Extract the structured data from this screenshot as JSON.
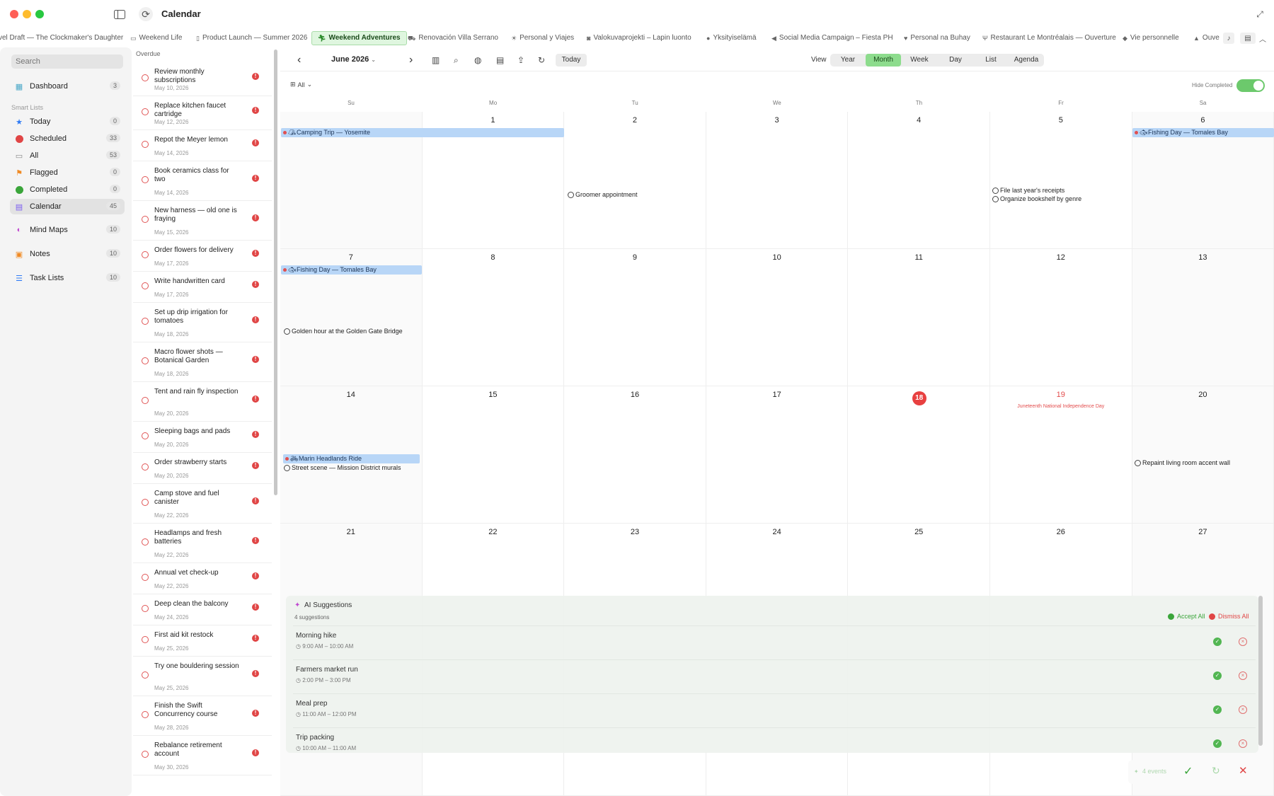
{
  "window": {
    "title": "Calendar"
  },
  "tabs": [
    {
      "label": "vel Draft — The Clockmaker's Daughter",
      "icon": ""
    },
    {
      "label": "Weekend Life",
      "icon": "sofa-icon"
    },
    {
      "label": "Product Launch — Summer 2026",
      "icon": "document-icon"
    },
    {
      "label": "Weekend Adventures",
      "icon": "hiker-icon"
    },
    {
      "label": "Renovación Villa Serrano",
      "icon": "excavator-icon"
    },
    {
      "label": "Personal y Viajes",
      "icon": "sun-icon"
    },
    {
      "label": "Valokuvaprojekti – Lapin luonto",
      "icon": "camera-icon"
    },
    {
      "label": "Yksityiselämä",
      "icon": "circle-icon"
    },
    {
      "label": "Social Media Campaign – Fiesta PH",
      "icon": "megaphone-icon"
    },
    {
      "label": "Personal na Buhay",
      "icon": "heart-icon"
    },
    {
      "label": "Restaurant Le Montréalais — Ouverture",
      "icon": "fork-icon"
    },
    {
      "label": "Vie personnelle",
      "icon": "tag-icon"
    },
    {
      "label": "Ouve",
      "icon": "triangle-icon"
    }
  ],
  "sidebar": {
    "search_placeholder": "Search",
    "dashboard": {
      "label": "Dashboard",
      "count": "3"
    },
    "smart_lists_label": "Smart Lists",
    "smart_lists": [
      {
        "label": "Today",
        "count": "0",
        "icon": "star-icon",
        "color": "#2f7bf5"
      },
      {
        "label": "Scheduled",
        "count": "33",
        "icon": "clock-icon",
        "color": "#e04545"
      },
      {
        "label": "All",
        "count": "53",
        "icon": "tray-icon",
        "color": "#888888"
      },
      {
        "label": "Flagged",
        "count": "0",
        "icon": "flag-icon",
        "color": "#f08a24"
      },
      {
        "label": "Completed",
        "count": "0",
        "icon": "check-circle-icon",
        "color": "#3aa53a"
      },
      {
        "label": "Calendar",
        "count": "45",
        "icon": "calendar-icon",
        "color": "#7a5cf0"
      }
    ],
    "other": [
      {
        "label": "Mind Maps",
        "count": "10",
        "icon": "brain-icon",
        "color": "#c04ad0"
      },
      {
        "label": "Notes",
        "count": "10",
        "icon": "note-icon",
        "color": "#f08a24"
      },
      {
        "label": "Task Lists",
        "count": "10",
        "icon": "list-icon",
        "color": "#2f7bf5"
      }
    ]
  },
  "overdue": {
    "header": "Overdue",
    "items": [
      {
        "title": "Review monthly subscriptions",
        "date": "May 10, 2026"
      },
      {
        "title": "Replace kitchen faucet cartridge",
        "date": "May 12, 2026"
      },
      {
        "title": "Repot the Meyer lemon",
        "date": "May 14, 2026"
      },
      {
        "title": "Book ceramics class for two",
        "date": "May 14, 2026"
      },
      {
        "title": "New harness — old one is fraying",
        "date": "May 15, 2026"
      },
      {
        "title": "Order flowers for delivery",
        "date": "May 17, 2026"
      },
      {
        "title": "Write handwritten card",
        "date": "May 17, 2026"
      },
      {
        "title": "Set up drip irrigation for tomatoes",
        "date": "May 18, 2026"
      },
      {
        "title": "Macro flower shots — Botanical Garden",
        "date": "May 18, 2026"
      },
      {
        "title": "Tent and rain fly inspection",
        "date": "May 20, 2026"
      },
      {
        "title": "Sleeping bags and pads",
        "date": "May 20, 2026"
      },
      {
        "title": "Order strawberry starts",
        "date": "May 20, 2026"
      },
      {
        "title": "Camp stove and fuel canister",
        "date": "May 22, 2026"
      },
      {
        "title": "Headlamps and fresh batteries",
        "date": "May 22, 2026"
      },
      {
        "title": "Annual vet check-up",
        "date": "May 22, 2026"
      },
      {
        "title": "Deep clean the balcony",
        "date": "May 24, 2026"
      },
      {
        "title": "First aid kit restock",
        "date": "May 25, 2026"
      },
      {
        "title": "Try one bouldering session",
        "date": "May 25, 2026"
      },
      {
        "title": "Finish the Swift Concurrency course",
        "date": "May 28, 2026"
      },
      {
        "title": "Rebalance retirement account",
        "date": "May 30, 2026"
      }
    ]
  },
  "calendar": {
    "month_label": "June 2026",
    "today_label": "Today",
    "view_label": "View",
    "views": [
      "Year",
      "Month",
      "Week",
      "Day",
      "List",
      "Agenda"
    ],
    "active_view": "Month",
    "filter_label": "All",
    "hide_completed_label": "Hide Completed",
    "weekdays": [
      "Su",
      "Mo",
      "Tu",
      "We",
      "Th",
      "Fr",
      "Sa"
    ],
    "weeks": [
      [
        "",
        "1",
        "2",
        "3",
        "4",
        "5",
        "6"
      ],
      [
        "7",
        "8",
        "9",
        "10",
        "11",
        "12",
        "13"
      ],
      [
        "14",
        "15",
        "16",
        "17",
        "18",
        "19",
        "20"
      ],
      [
        "21",
        "22",
        "23",
        "24",
        "25",
        "26",
        "27"
      ]
    ],
    "today_day": "18",
    "holiday": {
      "day": "19",
      "label": "Juneteenth National Independence Day"
    },
    "events": [
      {
        "title": "Camping Trip — Yosemite",
        "icon": "tent-icon"
      },
      {
        "title": "Fishing Day — Tomales Bay",
        "icon": "fish-icon"
      },
      {
        "title": "Fishing Day — Tomales Bay",
        "icon": "fish-icon"
      },
      {
        "title": "Marin Headlands Ride",
        "icon": "bike-icon"
      }
    ],
    "tasks": [
      {
        "title": "Groomer appointment"
      },
      {
        "title": "File last year's receipts"
      },
      {
        "title": "Organize bookshelf by genre"
      },
      {
        "title": "Golden hour at the Golden Gate Bridge"
      },
      {
        "title": "Street scene — Mission District murals"
      },
      {
        "title": "Repaint living room accent wall"
      }
    ]
  },
  "ai": {
    "title": "AI Suggestions",
    "count": "4 suggestions",
    "accept_all": "Accept All",
    "dismiss_all": "Dismiss All",
    "suggestions": [
      {
        "title": "Morning hike",
        "time": "9:00 AM – 10:00 AM"
      },
      {
        "title": "Farmers market run",
        "time": "2:00 PM – 3:00 PM"
      },
      {
        "title": "Meal prep",
        "time": "11:00 AM – 12:00 PM"
      },
      {
        "title": "Trip packing",
        "time": "10:00 AM – 11:00 AM"
      }
    ]
  },
  "bottom": {
    "label": "4 events"
  }
}
